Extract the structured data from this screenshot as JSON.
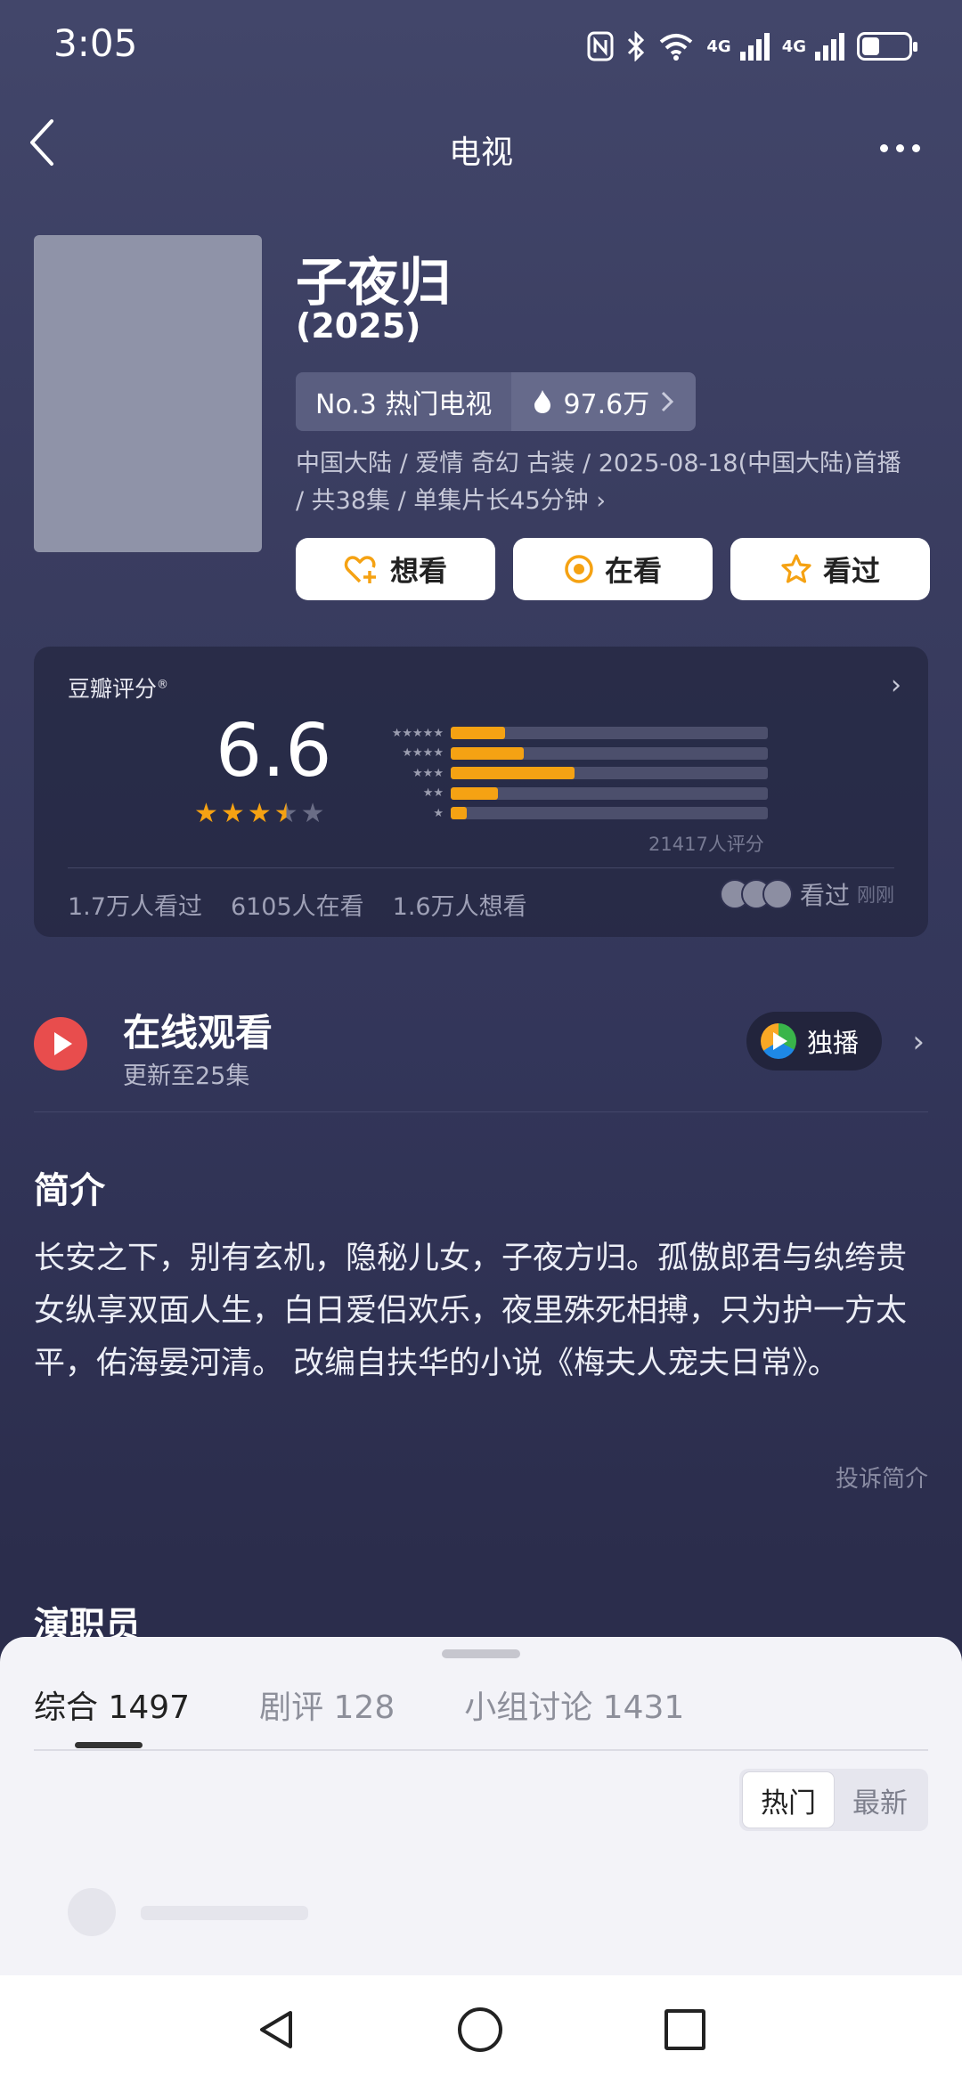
{
  "status_bar": {
    "time": "3:05",
    "net1": "4G",
    "net2": "4G",
    "icons": [
      "nfc-icon",
      "bluetooth-icon",
      "wifi-icon",
      "signal-icon",
      "signal-icon",
      "battery-icon"
    ]
  },
  "nav": {
    "title": "电视"
  },
  "show": {
    "title": "子夜归",
    "year": "(2025)",
    "rank_label": "No.3 热门电视",
    "heat": "97.6万",
    "meta": "中国大陆 / 爱情 奇幻 古装 / 2025-08-18(中国大陆)首播 / 共38集 / 单集片长45分钟 ›"
  },
  "actions": {
    "want": "想看",
    "watching": "在看",
    "watched": "看过"
  },
  "rating": {
    "label": "豆瓣评分",
    "registered": "®",
    "score": "6.6",
    "stars_filled": 3.5,
    "distribution": [
      {
        "stars": "★★★★★",
        "fraction": 0.17
      },
      {
        "stars": "★★★★",
        "fraction": 0.23
      },
      {
        "stars": "★★★",
        "fraction": 0.39
      },
      {
        "stars": "★★",
        "fraction": 0.15
      },
      {
        "stars": "★",
        "fraction": 0.05
      }
    ],
    "count": "21417人评分",
    "stats": [
      "1.7万人看过",
      "6105人在看",
      "1.6万人想看"
    ],
    "seen_label": "看过",
    "seen_time": "刚刚"
  },
  "online": {
    "title": "在线观看",
    "subtitle": "更新至25集",
    "badge": "独播"
  },
  "synopsis": {
    "title": "简介",
    "text": "长安之下，别有玄机，隐秘儿女，子夜方归。孤傲郎君与纨绔贵女纵享双面人生，白日爱侣欢乐，夜里殊死相搏，只为护一方太平，佑海晏河清。 改编自扶华的小说《梅夫人宠夫日常》。",
    "report": "投诉简介"
  },
  "cast": {
    "title": "演职员"
  },
  "sheet": {
    "tabs": [
      {
        "label": "综合 1497"
      },
      {
        "label": "剧评 128"
      },
      {
        "label": "小组讨论 1431"
      }
    ],
    "sort": [
      "热门",
      "最新"
    ]
  },
  "colors": {
    "accent_orange": "#f5a213",
    "play_red": "#e84d4d",
    "bg_top": "#42466a",
    "bg_bottom": "#2a2c4a"
  }
}
